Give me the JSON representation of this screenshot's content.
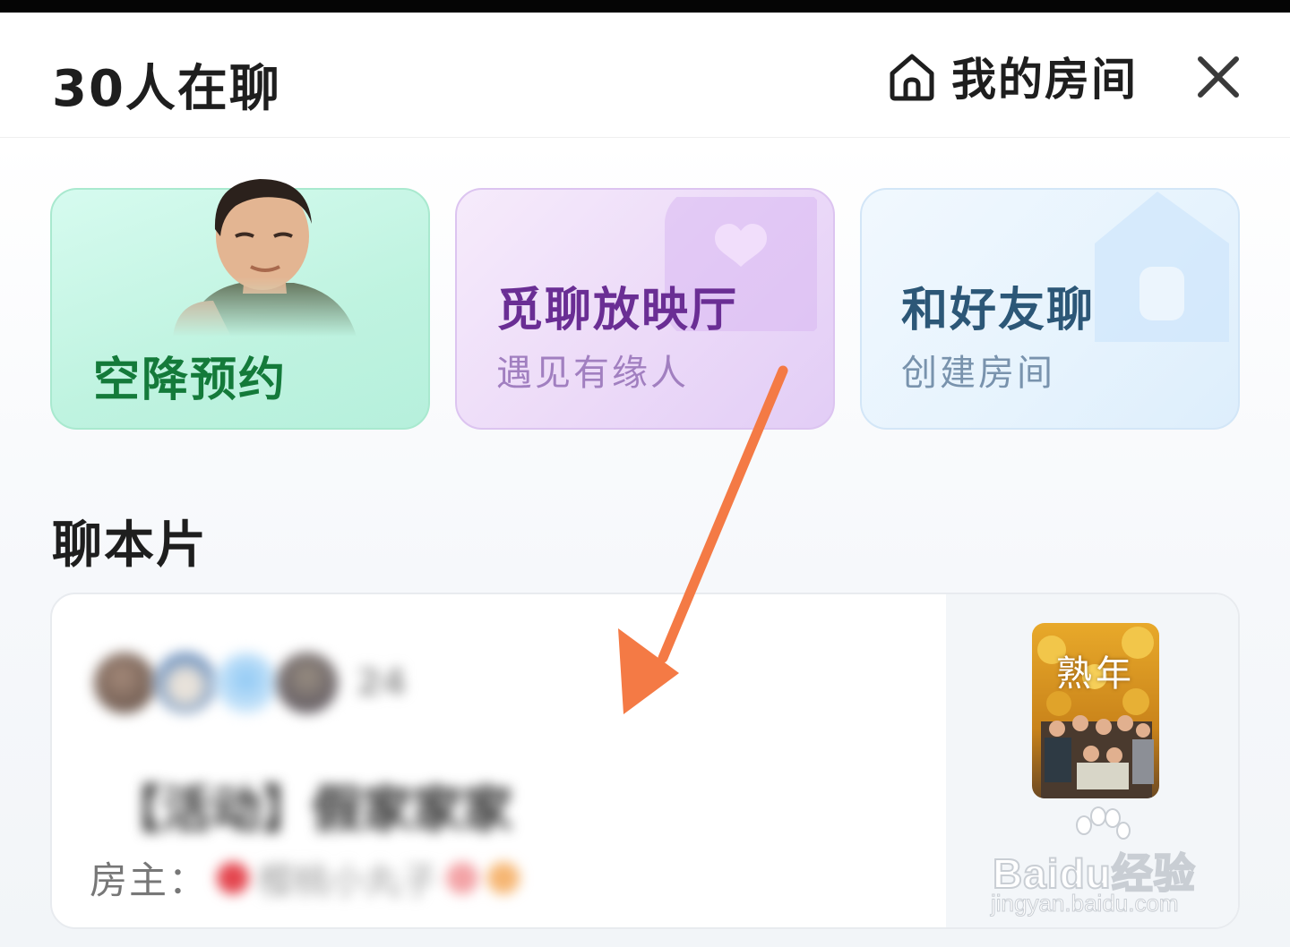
{
  "header": {
    "title": "30人在聊",
    "my_room_label": "我的房间"
  },
  "cards": {
    "airdrop": {
      "title": "空降预约"
    },
    "cinema": {
      "title": "觅聊放映厅",
      "subtitle": "遇见有缘人"
    },
    "friends": {
      "title": "和好友聊",
      "subtitle": "创建房间"
    }
  },
  "section": {
    "title": "聊本片"
  },
  "room": {
    "member_count": "24",
    "title": "【活动】假家家家",
    "owner_label": "房主：",
    "owner_name": "樱桃小丸子",
    "poster_title": "熟年"
  },
  "watermark": {
    "brand": "Baidu经验",
    "url": "jingyan.baidu.com"
  },
  "colors": {
    "annotation_arrow": "#f47a45",
    "airdrop_title": "#147a3a",
    "cinema_title": "#6a2e94",
    "friends_title": "#2c5777"
  }
}
